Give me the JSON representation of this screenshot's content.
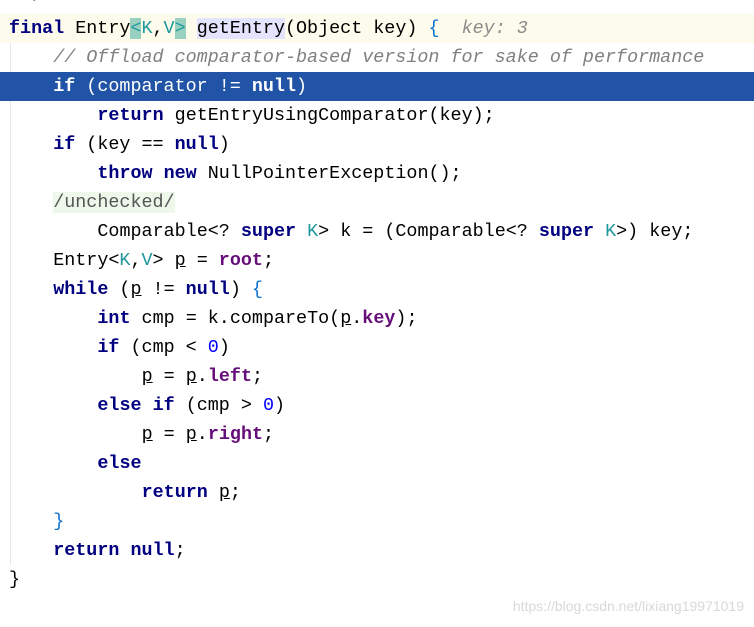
{
  "top_fragment": "*/",
  "watermark": "https://blog.csdn.net/lixiang19971019",
  "colors": {
    "selection": "#2154a6",
    "keyword": "#000080",
    "field": "#660e7a",
    "generic": "#20999d",
    "comment": "#808080",
    "number": "#0000ff"
  },
  "lines": [
    {
      "indent": 0,
      "row": "hdr",
      "tokens": [
        [
          "final ",
          "kw"
        ],
        [
          "Entry",
          ""
        ],
        [
          "<",
          "genh"
        ],
        [
          "K",
          "gen"
        ],
        [
          ",",
          ""
        ],
        [
          "V",
          "gen"
        ],
        [
          ">",
          "genh"
        ],
        [
          " ",
          ""
        ],
        [
          "getEntry",
          "mh"
        ],
        [
          "(Object key) ",
          ""
        ],
        [
          "{",
          "br"
        ],
        [
          "  key: 3",
          "hint"
        ]
      ]
    },
    {
      "indent": 1,
      "tokens": [
        [
          "// Offload comparator-based version for sake of performance",
          "cm"
        ]
      ]
    },
    {
      "indent": 1,
      "row": "sel",
      "tokens": [
        [
          "if ",
          "kw"
        ],
        [
          "(comparator != ",
          ""
        ],
        [
          "null",
          "kw"
        ],
        [
          ")",
          ""
        ]
      ]
    },
    {
      "indent": 2,
      "tokens": [
        [
          "return ",
          "kw"
        ],
        [
          "getEntryUsingComparator(key);",
          ""
        ]
      ]
    },
    {
      "indent": 1,
      "tokens": [
        [
          "if ",
          "kw"
        ],
        [
          "(key == ",
          ""
        ],
        [
          "null",
          "kw"
        ],
        [
          ")",
          ""
        ]
      ]
    },
    {
      "indent": 2,
      "tokens": [
        [
          "throw new ",
          "kw"
        ],
        [
          "NullPointerException();",
          ""
        ]
      ]
    },
    {
      "indent": 1,
      "tokens": [
        [
          "/unchecked/",
          "fold"
        ]
      ]
    },
    {
      "indent": 2,
      "tokens": [
        [
          "Comparable<? ",
          ""
        ],
        [
          "super ",
          "kw"
        ],
        [
          "K",
          "gen"
        ],
        [
          "> k = (Comparable<? ",
          ""
        ],
        [
          "super ",
          "kw"
        ],
        [
          "K",
          "gen"
        ],
        [
          ">) key;",
          ""
        ]
      ]
    },
    {
      "indent": 1,
      "tokens": [
        [
          "Entry<",
          ""
        ],
        [
          "K",
          "gen"
        ],
        [
          ",",
          ""
        ],
        [
          "V",
          "gen"
        ],
        [
          "> ",
          ""
        ],
        [
          "p",
          "ul"
        ],
        [
          " = ",
          ""
        ],
        [
          "root",
          "fld"
        ],
        [
          ";",
          ""
        ]
      ]
    },
    {
      "indent": 1,
      "tokens": [
        [
          "while ",
          "kw"
        ],
        [
          "(",
          ""
        ],
        [
          "p",
          "ul"
        ],
        [
          " != ",
          ""
        ],
        [
          "null",
          "kw"
        ],
        [
          ") ",
          ""
        ],
        [
          "{",
          "br"
        ]
      ]
    },
    {
      "indent": 2,
      "tokens": [
        [
          "int ",
          "kw"
        ],
        [
          "cmp = k.compareTo(",
          ""
        ],
        [
          "p",
          "ul"
        ],
        [
          ".",
          ""
        ],
        [
          "key",
          "fld"
        ],
        [
          ");",
          ""
        ]
      ]
    },
    {
      "indent": 2,
      "tokens": [
        [
          "if ",
          "kw"
        ],
        [
          "(cmp < ",
          ""
        ],
        [
          "0",
          "num"
        ],
        [
          ")",
          ""
        ]
      ]
    },
    {
      "indent": 3,
      "tokens": [
        [
          "p",
          "ul"
        ],
        [
          " = ",
          ""
        ],
        [
          "p",
          "ul"
        ],
        [
          ".",
          ""
        ],
        [
          "left",
          "fld"
        ],
        [
          ";",
          ""
        ]
      ]
    },
    {
      "indent": 2,
      "tokens": [
        [
          "else if ",
          "kw"
        ],
        [
          "(cmp > ",
          ""
        ],
        [
          "0",
          "num"
        ],
        [
          ")",
          ""
        ]
      ]
    },
    {
      "indent": 3,
      "tokens": [
        [
          "p",
          "ul"
        ],
        [
          " = ",
          ""
        ],
        [
          "p",
          "ul"
        ],
        [
          ".",
          ""
        ],
        [
          "right",
          "fld"
        ],
        [
          ";",
          ""
        ]
      ]
    },
    {
      "indent": 2,
      "tokens": [
        [
          "else",
          "kw"
        ]
      ]
    },
    {
      "indent": 3,
      "tokens": [
        [
          "return ",
          "kw"
        ],
        [
          "p",
          "ul"
        ],
        [
          ";",
          ""
        ]
      ]
    },
    {
      "indent": 1,
      "tokens": [
        [
          "}",
          "br"
        ]
      ]
    },
    {
      "indent": 1,
      "tokens": [
        [
          "return null",
          "kw"
        ],
        [
          ";",
          ""
        ]
      ]
    },
    {
      "indent": 0,
      "tokens": [
        [
          "}",
          ""
        ]
      ]
    }
  ]
}
